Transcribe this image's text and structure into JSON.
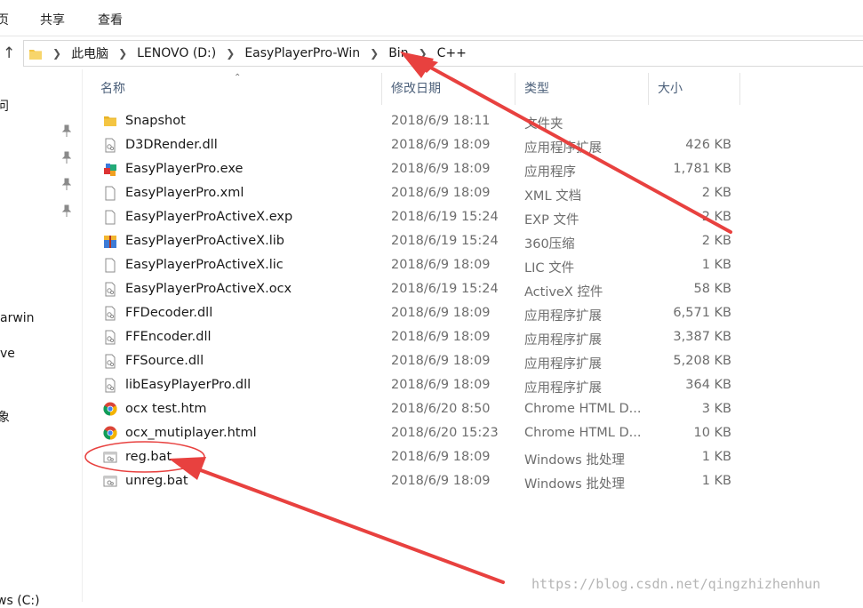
{
  "ribbon": {
    "tabs": [
      "页",
      "共享",
      "查看"
    ]
  },
  "address": {
    "crumbs": [
      "此电脑",
      "LENOVO (D:)",
      "EasyPlayerPro-Win",
      "Bin",
      "C++"
    ]
  },
  "navpane": {
    "items": [
      "问",
      "arwin",
      "ve",
      "象",
      "ws (C:)"
    ]
  },
  "columns": {
    "name": "名称",
    "date": "修改日期",
    "type": "类型",
    "size": "大小"
  },
  "files": [
    {
      "name": "Snapshot",
      "date": "2018/6/9 18:11",
      "type": "文件夹",
      "size": "",
      "icon": "folder-icon"
    },
    {
      "name": "D3DRender.dll",
      "date": "2018/6/9 18:09",
      "type": "应用程序扩展",
      "size": "426 KB",
      "icon": "dll-file-icon"
    },
    {
      "name": "EasyPlayerPro.exe",
      "date": "2018/6/9 18:09",
      "type": "应用程序",
      "size": "1,781 KB",
      "icon": "exe-app-icon"
    },
    {
      "name": "EasyPlayerPro.xml",
      "date": "2018/6/9 18:09",
      "type": "XML 文档",
      "size": "2 KB",
      "icon": "blank-file-icon"
    },
    {
      "name": "EasyPlayerProActiveX.exp",
      "date": "2018/6/19 15:24",
      "type": "EXP 文件",
      "size": "2 KB",
      "icon": "blank-file-icon"
    },
    {
      "name": "EasyPlayerProActiveX.lib",
      "date": "2018/6/19 15:24",
      "type": "360压缩",
      "size": "2 KB",
      "icon": "archive-file-icon"
    },
    {
      "name": "EasyPlayerProActiveX.lic",
      "date": "2018/6/9 18:09",
      "type": "LIC 文件",
      "size": "1 KB",
      "icon": "blank-file-icon"
    },
    {
      "name": "EasyPlayerProActiveX.ocx",
      "date": "2018/6/19 15:24",
      "type": "ActiveX 控件",
      "size": "58 KB",
      "icon": "dll-file-icon"
    },
    {
      "name": "FFDecoder.dll",
      "date": "2018/6/9 18:09",
      "type": "应用程序扩展",
      "size": "6,571 KB",
      "icon": "dll-file-icon"
    },
    {
      "name": "FFEncoder.dll",
      "date": "2018/6/9 18:09",
      "type": "应用程序扩展",
      "size": "3,387 KB",
      "icon": "dll-file-icon"
    },
    {
      "name": "FFSource.dll",
      "date": "2018/6/9 18:09",
      "type": "应用程序扩展",
      "size": "5,208 KB",
      "icon": "dll-file-icon"
    },
    {
      "name": "libEasyPlayerPro.dll",
      "date": "2018/6/9 18:09",
      "type": "应用程序扩展",
      "size": "364 KB",
      "icon": "dll-file-icon"
    },
    {
      "name": "ocx test.htm",
      "date": "2018/6/20 8:50",
      "type": "Chrome HTML D...",
      "size": "3 KB",
      "icon": "chrome-icon"
    },
    {
      "name": "ocx_mutiplayer.html",
      "date": "2018/6/20 15:23",
      "type": "Chrome HTML D...",
      "size": "10 KB",
      "icon": "chrome-icon"
    },
    {
      "name": "reg.bat",
      "date": "2018/6/9 18:09",
      "type": "Windows 批处理",
      "size": "1 KB",
      "icon": "batch-file-icon"
    },
    {
      "name": "unreg.bat",
      "date": "2018/6/9 18:09",
      "type": "Windows 批处理",
      "size": "1 KB",
      "icon": "batch-file-icon"
    }
  ],
  "watermark": "https://blog.csdn.net/qingzhizhenhun",
  "colors": {
    "annotation": "#e8413f",
    "folder": "#f4c542",
    "header_text": "#4c607a"
  }
}
